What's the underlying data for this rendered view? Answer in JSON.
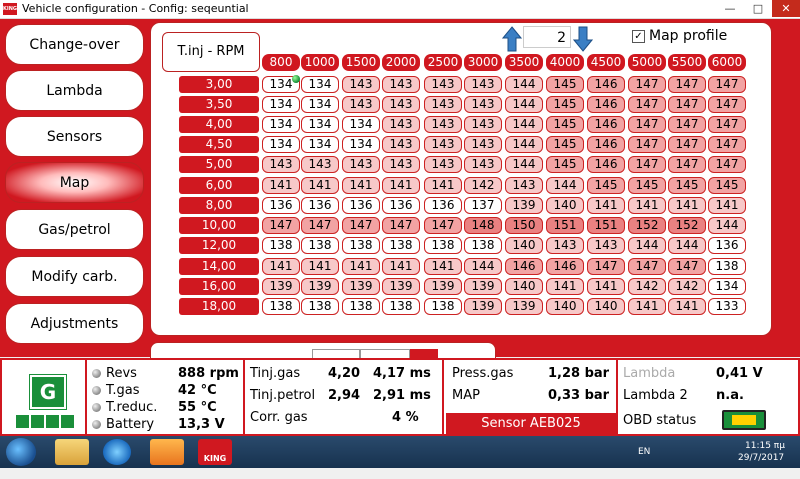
{
  "window": {
    "title": "Vehicle configuration - Config: seqeuntial",
    "app_badge": "KING",
    "btn_minimize": "—",
    "btn_maximize": "□",
    "btn_close": "✕"
  },
  "sidebar": {
    "items": [
      {
        "label": "Change-over"
      },
      {
        "label": "Lambda"
      },
      {
        "label": "Sensors"
      },
      {
        "label": "Map"
      },
      {
        "label": "Gas/petrol"
      },
      {
        "label": "Modify carb."
      },
      {
        "label": "Adjustments"
      }
    ],
    "active_index": 3
  },
  "map": {
    "header_label": "T.inj - RPM",
    "profile_number": "2",
    "profile_label": "Map profile",
    "profile_checked": true,
    "checkmark": "✓",
    "rpm_headers": [
      "800",
      "1000",
      "1500",
      "2000",
      "2500",
      "3000",
      "3500",
      "4000",
      "4500",
      "5000",
      "5500",
      "6000"
    ],
    "row_labels": [
      "3,00",
      "3,50",
      "4,00",
      "4,50",
      "5,00",
      "6,00",
      "8,00",
      "10,00",
      "12,00",
      "14,00",
      "16,00",
      "18,00"
    ],
    "rows": [
      [
        134,
        134,
        143,
        143,
        143,
        143,
        144,
        145,
        146,
        147,
        147,
        147
      ],
      [
        134,
        134,
        143,
        143,
        143,
        143,
        144,
        145,
        146,
        147,
        147,
        147
      ],
      [
        134,
        134,
        134,
        143,
        143,
        143,
        144,
        145,
        146,
        147,
        147,
        147
      ],
      [
        134,
        134,
        134,
        143,
        143,
        143,
        144,
        145,
        146,
        147,
        147,
        147
      ],
      [
        143,
        143,
        143,
        143,
        143,
        143,
        144,
        145,
        146,
        147,
        147,
        147
      ],
      [
        141,
        141,
        141,
        141,
        141,
        142,
        143,
        144,
        145,
        145,
        145,
        145
      ],
      [
        136,
        136,
        136,
        136,
        136,
        137,
        139,
        140,
        141,
        141,
        141,
        141
      ],
      [
        147,
        147,
        147,
        147,
        147,
        148,
        150,
        151,
        151,
        152,
        152,
        144
      ],
      [
        138,
        138,
        138,
        138,
        138,
        138,
        140,
        143,
        143,
        144,
        144,
        136
      ],
      [
        141,
        141,
        141,
        141,
        141,
        144,
        146,
        146,
        147,
        147,
        147,
        138
      ],
      [
        139,
        139,
        139,
        139,
        139,
        139,
        140,
        141,
        141,
        142,
        142,
        134
      ],
      [
        138,
        138,
        138,
        138,
        138,
        139,
        139,
        140,
        140,
        141,
        141,
        133
      ]
    ],
    "cell_colors": {
      "white": "#ffffff",
      "light": "#f7c8c8",
      "medium": "#f2a3a3",
      "dark": "#ea8181"
    },
    "cursor_cell": {
      "row": 0,
      "col": 0
    }
  },
  "status": {
    "gas_indicator": "G",
    "gauges": [
      {
        "label": "Revs",
        "value": "888 rpm"
      },
      {
        "label": "T.gas",
        "value": "42 °C"
      },
      {
        "label": "T.reduc.",
        "value": "55 °C"
      },
      {
        "label": "Battery",
        "value": "13,3 V"
      }
    ],
    "tinj_gas_label": "Tinj.gas",
    "tinj_gas_value": "4,20",
    "tinj_gas_ms": "4,17 ms",
    "tinj_petrol_label": "Tinj.petrol",
    "tinj_petrol_value": "2,94",
    "tinj_petrol_ms": "2,91 ms",
    "corr_gas_label": "Corr. gas",
    "corr_gas_value": "4 %",
    "press_gas_label": "Press.gas",
    "press_gas_value": "1,28 bar",
    "map_label": "MAP",
    "map_value": "0,33 bar",
    "sensor_label": "Sensor AEB025",
    "lambda_label": "Lambda",
    "lambda_value": "0,41 V",
    "lambda2_label": "Lambda 2",
    "lambda2_value": "n.a.",
    "obd_label": "OBD status"
  },
  "taskbar": {
    "king_label": "KING",
    "lang": "EN",
    "time": "11:15 πμ",
    "date": "29/7/2017"
  },
  "colors": {
    "brand_red": "#d01820",
    "gas_green": "#1a8f3a"
  }
}
